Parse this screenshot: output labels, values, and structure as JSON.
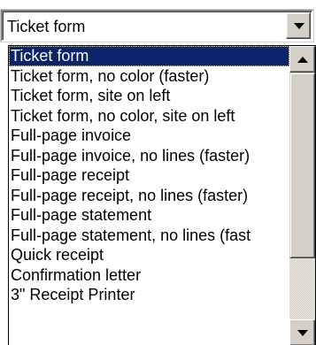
{
  "combo": {
    "value": "Ticket form"
  },
  "dropdown": {
    "items": [
      {
        "label": "Ticket form",
        "selected": true
      },
      {
        "label": "Ticket form, no color (faster)"
      },
      {
        "label": "Ticket form, site on left"
      },
      {
        "label": "Ticket form, no color, site on left"
      },
      {
        "label": "Full-page invoice"
      },
      {
        "label": "Full-page invoice, no lines (faster)"
      },
      {
        "label": "Full-page receipt"
      },
      {
        "label": "Full-page receipt, no lines (faster)"
      },
      {
        "label": "Full-page statement"
      },
      {
        "label": "Full-page statement, no lines (fast"
      },
      {
        "label": "Quick receipt"
      },
      {
        "label": "Confirmation letter"
      },
      {
        "label": "3\" Receipt Printer"
      }
    ]
  },
  "icons": {
    "combo_arrow": "chevron-down-icon",
    "scroll_up": "scroll-up-arrow-icon",
    "scroll_down": "scroll-down-arrow-icon"
  },
  "colors": {
    "selection_bg": "#0a246a",
    "selection_text": "#ffffff",
    "chrome": "#d4d0c8"
  }
}
